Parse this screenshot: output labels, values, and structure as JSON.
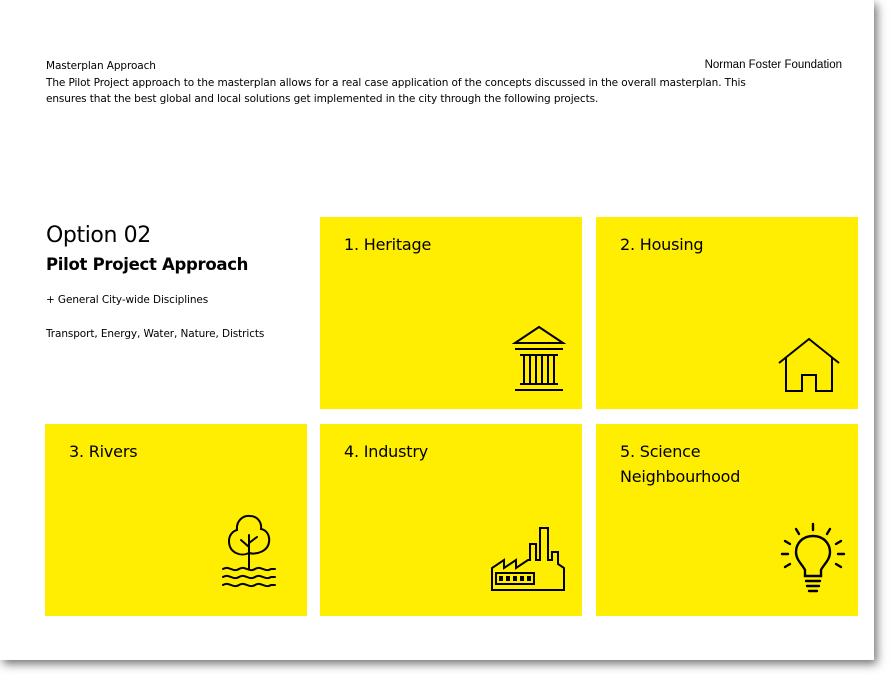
{
  "header": {
    "title": "Masterplan Approach",
    "brand": "Norman Foster Foundation"
  },
  "intro": "The Pilot Project approach to the masterplan allows for a real case application of the concepts discussed in the overall masterplan. This ensures that the best global and local solutions get implemented in the city through the following projects.",
  "option": {
    "title": "Option 02",
    "subtitle": "Pilot Project Approach",
    "disciplines_heading": "+ General City-wide Disciplines",
    "disciplines_list": "Transport, Energy, Water, Nature, Districts"
  },
  "colors": {
    "tile": "#ffee00",
    "icon": "#000000"
  },
  "projects": [
    {
      "label": "1. Heritage",
      "icon": "classical-building-icon"
    },
    {
      "label": "2. Housing",
      "icon": "house-icon"
    },
    {
      "label": "3. Rivers",
      "icon": "tree-river-icon"
    },
    {
      "label": "4. Industry",
      "icon": "factory-icon"
    },
    {
      "label": "5. Science\nNeighbourhood",
      "icon": "lightbulb-icon"
    }
  ]
}
